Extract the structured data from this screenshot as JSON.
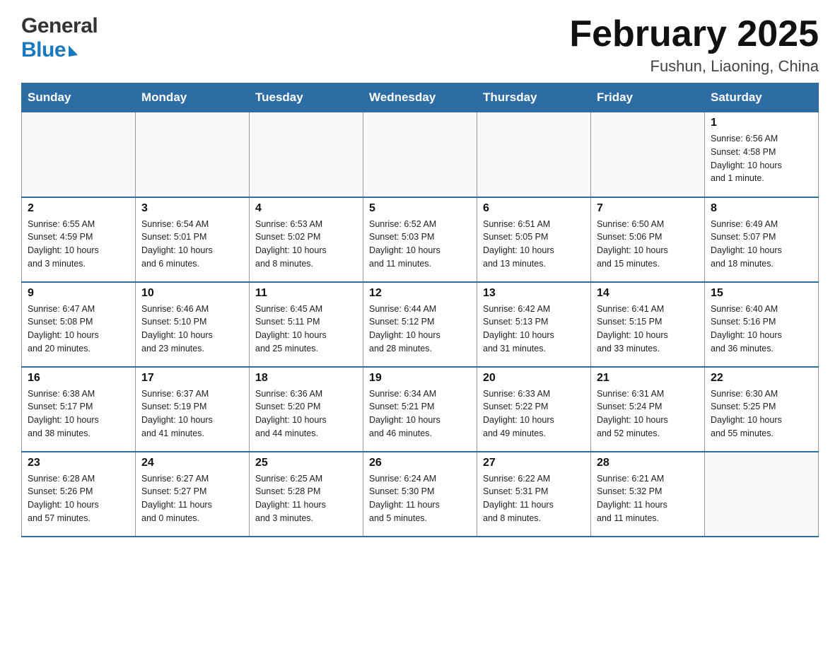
{
  "header": {
    "logo_line1": "General",
    "logo_line2": "Blue",
    "month_title": "February 2025",
    "location": "Fushun, Liaoning, China"
  },
  "calendar": {
    "days_of_week": [
      "Sunday",
      "Monday",
      "Tuesday",
      "Wednesday",
      "Thursday",
      "Friday",
      "Saturday"
    ],
    "weeks": [
      [
        {
          "day": "",
          "info": ""
        },
        {
          "day": "",
          "info": ""
        },
        {
          "day": "",
          "info": ""
        },
        {
          "day": "",
          "info": ""
        },
        {
          "day": "",
          "info": ""
        },
        {
          "day": "",
          "info": ""
        },
        {
          "day": "1",
          "info": "Sunrise: 6:56 AM\nSunset: 4:58 PM\nDaylight: 10 hours\nand 1 minute."
        }
      ],
      [
        {
          "day": "2",
          "info": "Sunrise: 6:55 AM\nSunset: 4:59 PM\nDaylight: 10 hours\nand 3 minutes."
        },
        {
          "day": "3",
          "info": "Sunrise: 6:54 AM\nSunset: 5:01 PM\nDaylight: 10 hours\nand 6 minutes."
        },
        {
          "day": "4",
          "info": "Sunrise: 6:53 AM\nSunset: 5:02 PM\nDaylight: 10 hours\nand 8 minutes."
        },
        {
          "day": "5",
          "info": "Sunrise: 6:52 AM\nSunset: 5:03 PM\nDaylight: 10 hours\nand 11 minutes."
        },
        {
          "day": "6",
          "info": "Sunrise: 6:51 AM\nSunset: 5:05 PM\nDaylight: 10 hours\nand 13 minutes."
        },
        {
          "day": "7",
          "info": "Sunrise: 6:50 AM\nSunset: 5:06 PM\nDaylight: 10 hours\nand 15 minutes."
        },
        {
          "day": "8",
          "info": "Sunrise: 6:49 AM\nSunset: 5:07 PM\nDaylight: 10 hours\nand 18 minutes."
        }
      ],
      [
        {
          "day": "9",
          "info": "Sunrise: 6:47 AM\nSunset: 5:08 PM\nDaylight: 10 hours\nand 20 minutes."
        },
        {
          "day": "10",
          "info": "Sunrise: 6:46 AM\nSunset: 5:10 PM\nDaylight: 10 hours\nand 23 minutes."
        },
        {
          "day": "11",
          "info": "Sunrise: 6:45 AM\nSunset: 5:11 PM\nDaylight: 10 hours\nand 25 minutes."
        },
        {
          "day": "12",
          "info": "Sunrise: 6:44 AM\nSunset: 5:12 PM\nDaylight: 10 hours\nand 28 minutes."
        },
        {
          "day": "13",
          "info": "Sunrise: 6:42 AM\nSunset: 5:13 PM\nDaylight: 10 hours\nand 31 minutes."
        },
        {
          "day": "14",
          "info": "Sunrise: 6:41 AM\nSunset: 5:15 PM\nDaylight: 10 hours\nand 33 minutes."
        },
        {
          "day": "15",
          "info": "Sunrise: 6:40 AM\nSunset: 5:16 PM\nDaylight: 10 hours\nand 36 minutes."
        }
      ],
      [
        {
          "day": "16",
          "info": "Sunrise: 6:38 AM\nSunset: 5:17 PM\nDaylight: 10 hours\nand 38 minutes."
        },
        {
          "day": "17",
          "info": "Sunrise: 6:37 AM\nSunset: 5:19 PM\nDaylight: 10 hours\nand 41 minutes."
        },
        {
          "day": "18",
          "info": "Sunrise: 6:36 AM\nSunset: 5:20 PM\nDaylight: 10 hours\nand 44 minutes."
        },
        {
          "day": "19",
          "info": "Sunrise: 6:34 AM\nSunset: 5:21 PM\nDaylight: 10 hours\nand 46 minutes."
        },
        {
          "day": "20",
          "info": "Sunrise: 6:33 AM\nSunset: 5:22 PM\nDaylight: 10 hours\nand 49 minutes."
        },
        {
          "day": "21",
          "info": "Sunrise: 6:31 AM\nSunset: 5:24 PM\nDaylight: 10 hours\nand 52 minutes."
        },
        {
          "day": "22",
          "info": "Sunrise: 6:30 AM\nSunset: 5:25 PM\nDaylight: 10 hours\nand 55 minutes."
        }
      ],
      [
        {
          "day": "23",
          "info": "Sunrise: 6:28 AM\nSunset: 5:26 PM\nDaylight: 10 hours\nand 57 minutes."
        },
        {
          "day": "24",
          "info": "Sunrise: 6:27 AM\nSunset: 5:27 PM\nDaylight: 11 hours\nand 0 minutes."
        },
        {
          "day": "25",
          "info": "Sunrise: 6:25 AM\nSunset: 5:28 PM\nDaylight: 11 hours\nand 3 minutes."
        },
        {
          "day": "26",
          "info": "Sunrise: 6:24 AM\nSunset: 5:30 PM\nDaylight: 11 hours\nand 5 minutes."
        },
        {
          "day": "27",
          "info": "Sunrise: 6:22 AM\nSunset: 5:31 PM\nDaylight: 11 hours\nand 8 minutes."
        },
        {
          "day": "28",
          "info": "Sunrise: 6:21 AM\nSunset: 5:32 PM\nDaylight: 11 hours\nand 11 minutes."
        },
        {
          "day": "",
          "info": ""
        }
      ]
    ]
  }
}
